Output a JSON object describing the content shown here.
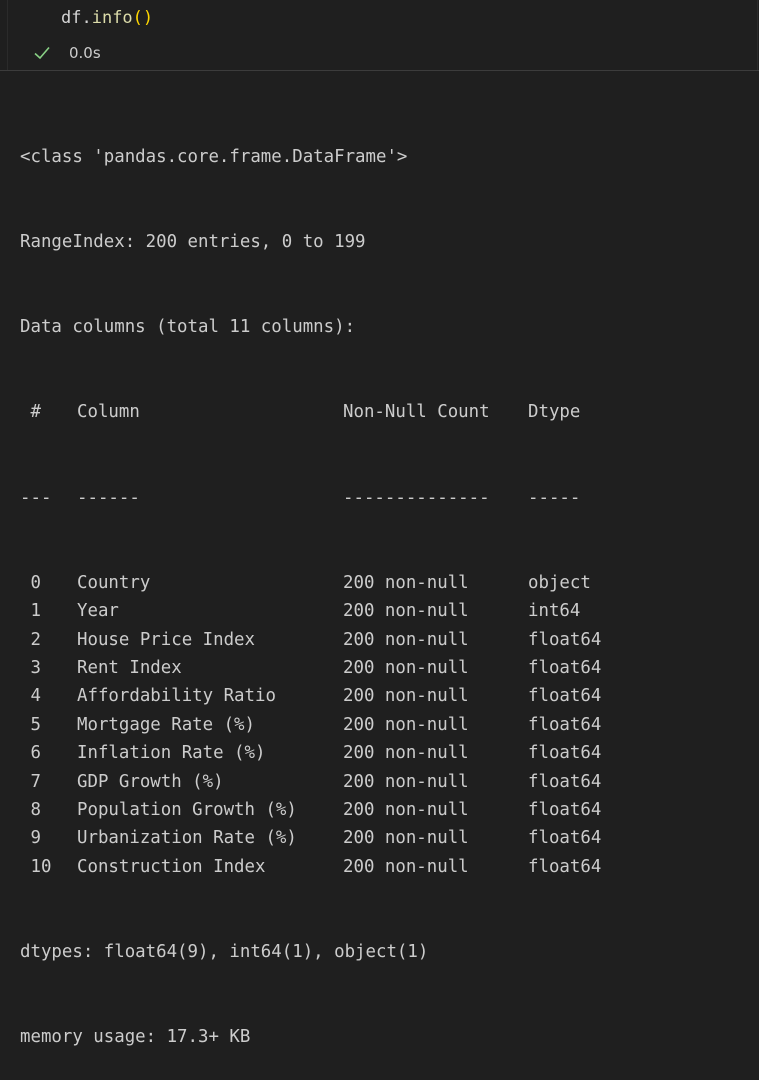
{
  "cell": {
    "code_ident": "df.",
    "code_func": "info",
    "code_parens": "()",
    "status_icon": "check-icon",
    "exec_time": "0.0s"
  },
  "output": {
    "class_line": "<class 'pandas.core.frame.DataFrame'>",
    "range_index": "RangeIndex: 200 entries, 0 to 199",
    "data_columns": "Data columns (total 11 columns):",
    "header": {
      "idx": " #",
      "name": "Column",
      "nn": "Non-Null Count",
      "dtype": "Dtype"
    },
    "sep": {
      "idx": "---",
      "name": "------",
      "nn": "--------------",
      "dtype": "-----"
    },
    "rows": [
      {
        "idx": " 0",
        "name": "Country",
        "nn": "200 non-null",
        "dtype": "object"
      },
      {
        "idx": " 1",
        "name": "Year",
        "nn": "200 non-null",
        "dtype": "int64"
      },
      {
        "idx": " 2",
        "name": "House Price Index",
        "nn": "200 non-null",
        "dtype": "float64"
      },
      {
        "idx": " 3",
        "name": "Rent Index",
        "nn": "200 non-null",
        "dtype": "float64"
      },
      {
        "idx": " 4",
        "name": "Affordability Ratio",
        "nn": "200 non-null",
        "dtype": "float64"
      },
      {
        "idx": " 5",
        "name": "Mortgage Rate (%)",
        "nn": "200 non-null",
        "dtype": "float64"
      },
      {
        "idx": " 6",
        "name": "Inflation Rate (%)",
        "nn": "200 non-null",
        "dtype": "float64"
      },
      {
        "idx": " 7",
        "name": "GDP Growth (%)",
        "nn": "200 non-null",
        "dtype": "float64"
      },
      {
        "idx": " 8",
        "name": "Population Growth (%)",
        "nn": "200 non-null",
        "dtype": "float64"
      },
      {
        "idx": " 9",
        "name": "Urbanization Rate (%)",
        "nn": "200 non-null",
        "dtype": "float64"
      },
      {
        "idx": " 10",
        "name": "Construction Index",
        "nn": "200 non-null",
        "dtype": "float64"
      }
    ],
    "dtypes_line": "dtypes: float64(9), int64(1), object(1)",
    "memory_line": "memory usage: 17.3+ KB"
  },
  "colors": {
    "background": "#1f1f1f",
    "text": "#cccccc",
    "success_check": "#89d185",
    "paren": "#ffd700",
    "function": "#dcdcaa"
  }
}
